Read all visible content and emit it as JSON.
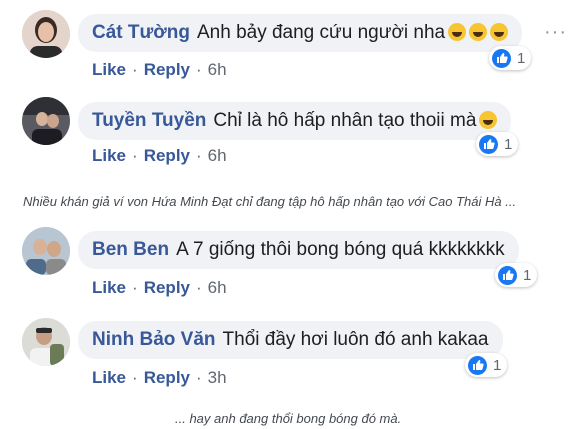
{
  "comments": [
    {
      "name": "Cát Tường",
      "text": "Anh bảy đang cứu người nha",
      "emoji": [
        "grinning-emoji",
        "grinning-emoji",
        "grinning-emoji"
      ],
      "like": "Like",
      "reply": "Reply",
      "time": "6h",
      "count": "1",
      "more": "···"
    },
    {
      "name": "Tuyền Tuyền",
      "text": "Chỉ là hô hấp nhân tạo thoii mà",
      "emoji": [
        "grinning-emoji"
      ],
      "like": "Like",
      "reply": "Reply",
      "time": "6h",
      "count": "1"
    },
    {
      "name": "Ben Ben",
      "text": "A 7 giống thôi bong bóng quá kkkkkkkk",
      "like": "Like",
      "reply": "Reply",
      "time": "6h",
      "count": "1"
    },
    {
      "name": "Ninh Bảo Văn",
      "text": "Thổi đầy hơi luôn đó anh kakaa",
      "like": "Like",
      "reply": "Reply",
      "time": "3h",
      "count": "1"
    }
  ],
  "captions": {
    "first": "Nhiều khán giả ví von Hứa Minh Đạt chỉ đang tập hô hấp nhân tạo với Cao Thái Hà ...",
    "second": "... hay anh đang thổi bong bóng đó mà."
  },
  "colors": {
    "name": "#385898",
    "bubble": "#f0f2f5",
    "like_badge": "#1877f2"
  },
  "icons": {
    "reaction": "thumbs-up-icon",
    "more": "more-dots-icon"
  }
}
